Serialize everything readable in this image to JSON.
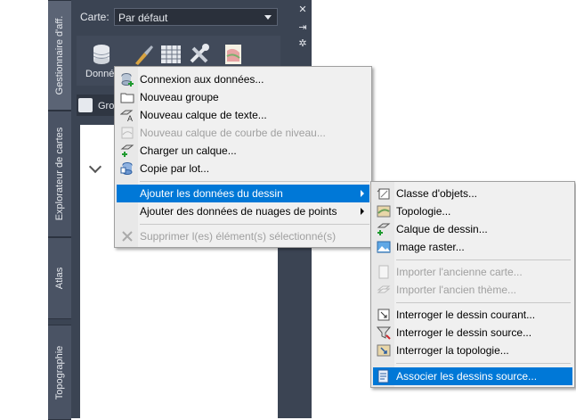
{
  "palette": {
    "tabs": [
      "Gestionnaire d'aff.",
      "Explorateur de cartes",
      "Atlas",
      "Topographie"
    ],
    "carte_label": "Carte:",
    "carte_value": "Par défaut",
    "tool_data_label": "Donné",
    "gr_label": "Gro"
  },
  "context_menu": {
    "items": [
      {
        "label": "Connexion aux données...",
        "icon": "database-connect-icon"
      },
      {
        "label": "Nouveau groupe",
        "icon": "folder-icon"
      },
      {
        "label": "Nouveau calque de texte...",
        "icon": "text-layer-icon"
      },
      {
        "label": "Nouveau calque de courbe de niveau...",
        "icon": "contour-layer-icon"
      },
      {
        "label": "Charger un calque...",
        "icon": "load-layer-icon"
      },
      {
        "label": "Copie par lot...",
        "icon": "batch-copy-icon"
      },
      {
        "label": "Ajouter les données du dessin",
        "icon": ""
      },
      {
        "label": "Ajouter des données de nuages de points",
        "icon": ""
      },
      {
        "label": "Supprimer l(es) élément(s) sélectionné(s)",
        "icon": "delete-x-icon"
      }
    ]
  },
  "submenu": {
    "items": [
      {
        "label": "Classe d'objets...",
        "icon": "feature-class-icon"
      },
      {
        "label": "Topologie...",
        "icon": "topology-icon"
      },
      {
        "label": "Calque de dessin...",
        "icon": "drawing-layer-icon"
      },
      {
        "label": "Image raster...",
        "icon": "raster-image-icon"
      },
      {
        "label": "Importer l'ancienne carte...",
        "icon": "import-map-icon"
      },
      {
        "label": "Importer l'ancien thème...",
        "icon": "import-theme-icon"
      },
      {
        "label": "Interroger le dessin courant...",
        "icon": "query-current-icon"
      },
      {
        "label": "Interroger le dessin source...",
        "icon": "query-source-icon"
      },
      {
        "label": "Interroger la topologie...",
        "icon": "query-topology-icon"
      },
      {
        "label": "Associer les dessins source...",
        "icon": "attach-source-icon"
      }
    ]
  },
  "colors": {
    "highlight": "#0078d7",
    "panel": "#3b4453",
    "menu_bg": "#f0f0f0"
  }
}
